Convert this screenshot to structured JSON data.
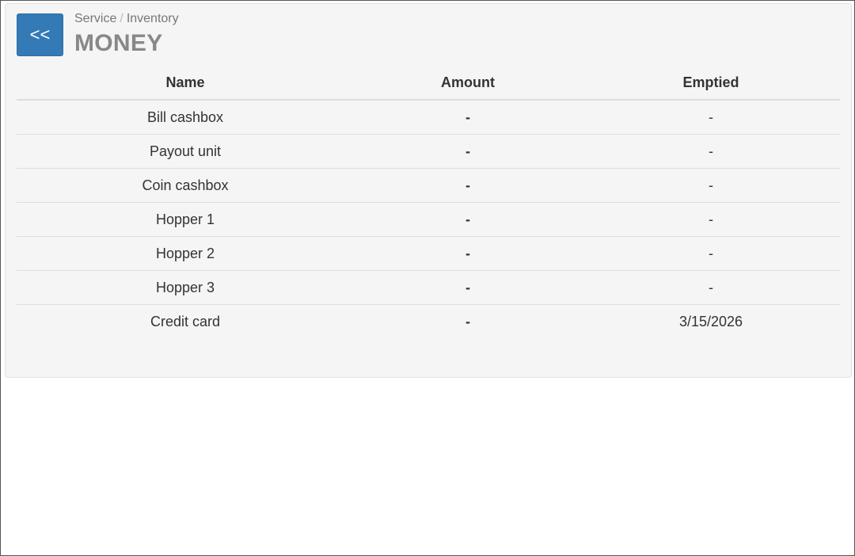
{
  "header": {
    "back_label": "<<",
    "breadcrumb": [
      "Service",
      "Inventory"
    ],
    "breadcrumb_separator": "/",
    "title": "MONEY"
  },
  "table": {
    "columns": [
      "Name",
      "Amount",
      "Emptied"
    ],
    "rows": [
      {
        "name": "Bill cashbox",
        "amount": "-",
        "emptied": "-"
      },
      {
        "name": "Payout unit",
        "amount": "-",
        "emptied": "-"
      },
      {
        "name": "Coin cashbox",
        "amount": "-",
        "emptied": "-"
      },
      {
        "name": "Hopper 1",
        "amount": "-",
        "emptied": "-"
      },
      {
        "name": "Hopper 2",
        "amount": "-",
        "emptied": "-"
      },
      {
        "name": "Hopper 3",
        "amount": "-",
        "emptied": "-"
      },
      {
        "name": "Credit card",
        "amount": "-",
        "emptied": "3/15/2026"
      }
    ]
  },
  "colors": {
    "accent": "#337ab7",
    "panel_background": "#f5f5f5",
    "title": "#888888"
  }
}
